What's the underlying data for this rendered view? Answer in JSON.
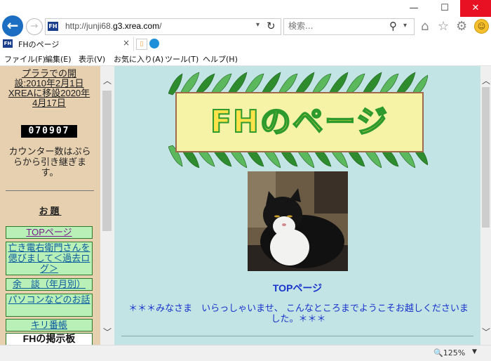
{
  "window": {
    "minimize": "—",
    "maximize": "☐",
    "close": "✕"
  },
  "nav": {
    "back": "←",
    "forward": "→",
    "favicon_text": "FH",
    "url_prefix": "http://junji68.",
    "url_domain": "g3.xrea.com",
    "url_suffix": "/",
    "search_placeholder": "検索...",
    "refresh": "↻",
    "search_icon": "⚲",
    "dropdown": "▾"
  },
  "tab": {
    "title": "FHのページ",
    "close": "×",
    "favicon_text": "FH"
  },
  "menu": [
    "ファイル(F)",
    "編集(E)",
    "表示(V)",
    "お気に入り(A)",
    "ツール(T)",
    "ヘルプ(H)"
  ],
  "sidebar": {
    "intro": [
      "プララでの開",
      "設:2010年2月1日",
      "XREAに移設2020年",
      "4月17日"
    ],
    "counter": "070907",
    "counter_note": [
      "カウンター数はぷら",
      "らから引き継ぎま",
      "す。"
    ],
    "heading": "お題",
    "nav": [
      {
        "label": "TOPページ"
      },
      {
        "label": "亡き電右衛門さんを偲びまして＜過去ログ＞"
      },
      {
        "label": "余　談（年月別）"
      },
      {
        "label": "パソコンなどのお話"
      },
      {
        "label": "キリ番帳"
      },
      {
        "label": "FHの掲示板"
      }
    ]
  },
  "main": {
    "banner_title": "FHのページ",
    "subtitle": "TOPページ",
    "welcome_line1": "＊＊＊みなさま　いらっしゃいませ、 こんなところまでようこそお越しくださいま",
    "welcome_line2": "した。＊＊＊"
  },
  "status": {
    "zoom": "125%"
  },
  "colors": {
    "sidebar_bg": "#e6d0b0",
    "main_bg": "#c2e4e4",
    "link": "#1833cc",
    "nav_box": "#b8f0b8"
  }
}
